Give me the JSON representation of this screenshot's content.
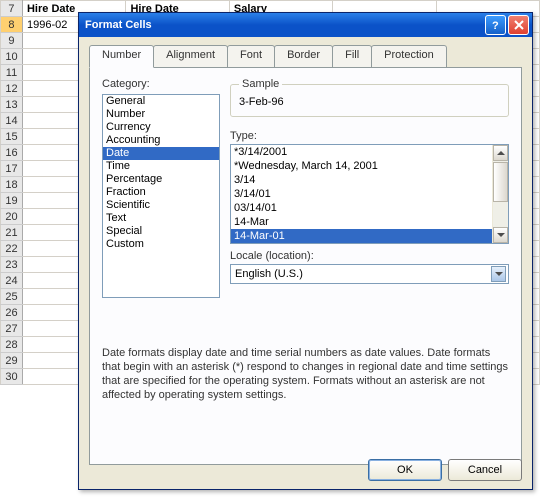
{
  "sheet": {
    "rows": [
      {
        "n": "7",
        "sel": false,
        "a": "Hire Date",
        "b": "Hire Date",
        "c": "Salary",
        "bold": true
      },
      {
        "n": "8",
        "sel": true,
        "a": "1996-02",
        "b": "",
        "c": "",
        "bold": false
      },
      {
        "n": "9",
        "sel": false
      },
      {
        "n": "10",
        "sel": false
      },
      {
        "n": "11",
        "sel": false
      },
      {
        "n": "12",
        "sel": false
      },
      {
        "n": "13",
        "sel": false
      },
      {
        "n": "14",
        "sel": false
      },
      {
        "n": "15",
        "sel": false
      },
      {
        "n": "16",
        "sel": false
      },
      {
        "n": "17",
        "sel": false
      },
      {
        "n": "18",
        "sel": false
      },
      {
        "n": "19",
        "sel": false
      },
      {
        "n": "20",
        "sel": false
      },
      {
        "n": "21",
        "sel": false
      },
      {
        "n": "22",
        "sel": false
      },
      {
        "n": "23",
        "sel": false
      },
      {
        "n": "24",
        "sel": false
      },
      {
        "n": "25",
        "sel": false
      },
      {
        "n": "26",
        "sel": false
      },
      {
        "n": "27",
        "sel": false
      },
      {
        "n": "28",
        "sel": false
      },
      {
        "n": "29",
        "sel": false
      },
      {
        "n": "30",
        "sel": false
      }
    ]
  },
  "dialog": {
    "title": "Format Cells",
    "tabs": [
      "Number",
      "Alignment",
      "Font",
      "Border",
      "Fill",
      "Protection"
    ],
    "tab_active": 0,
    "category_label": "Category:",
    "categories": [
      "General",
      "Number",
      "Currency",
      "Accounting",
      "Date",
      "Time",
      "Percentage",
      "Fraction",
      "Scientific",
      "Text",
      "Special",
      "Custom"
    ],
    "category_sel": 4,
    "sample_label": "Sample",
    "sample_value": "3-Feb-96",
    "type_label": "Type:",
    "types": [
      "*3/14/2001",
      "*Wednesday, March 14, 2001",
      "3/14",
      "3/14/01",
      "03/14/01",
      "14-Mar",
      "14-Mar-01"
    ],
    "type_sel": 6,
    "locale_label": "Locale (location):",
    "locale_value": "English (U.S.)",
    "explain": "Date formats display date and time serial numbers as date values.  Date formats that begin with an asterisk (*) respond to changes in regional date and time settings that are specified for the operating system. Formats without an asterisk are not affected by operating system settings.",
    "ok": "OK",
    "cancel": "Cancel"
  }
}
